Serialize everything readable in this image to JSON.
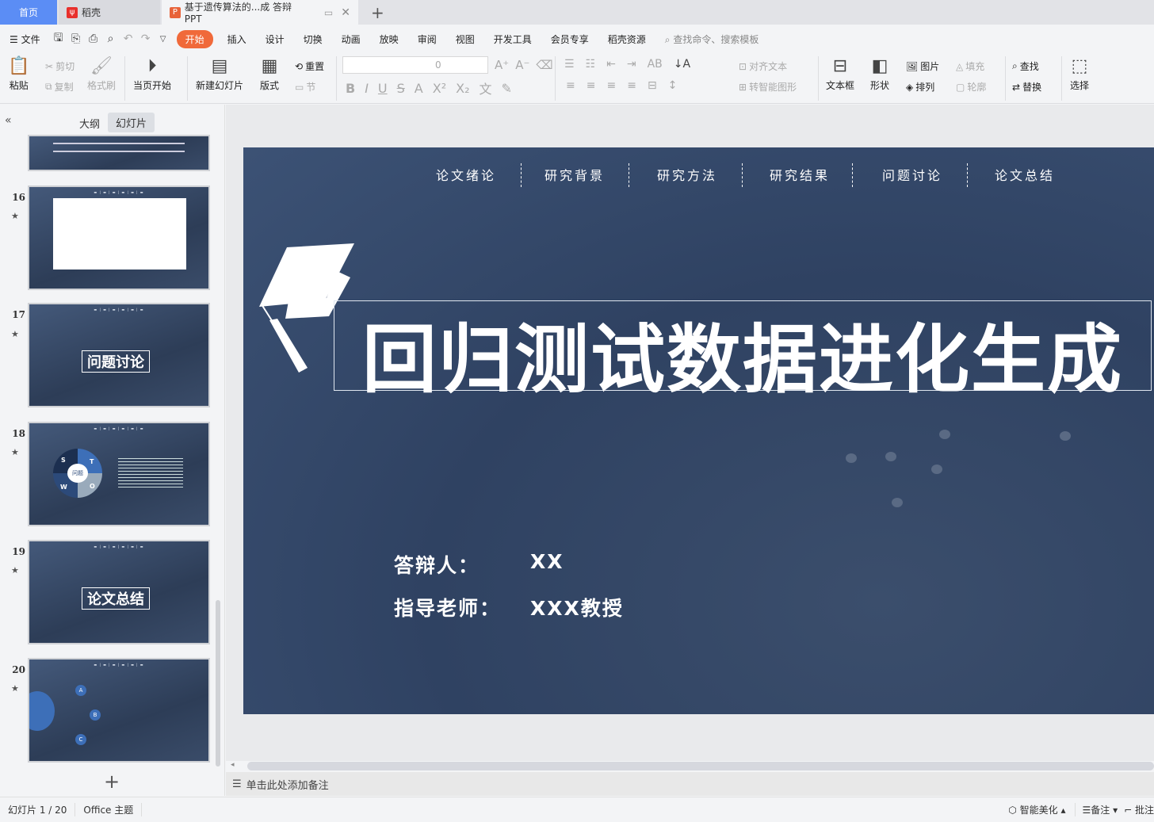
{
  "tabs": {
    "home": "首页",
    "daoke": "稻壳",
    "doc": "基于遗传算法的...成 答辩PPT",
    "new_tab": "+"
  },
  "menu": {
    "file": "文件",
    "items": [
      "开始",
      "插入",
      "设计",
      "切换",
      "动画",
      "放映",
      "审阅",
      "视图",
      "开发工具",
      "会员专享",
      "稻壳资源"
    ],
    "active": "开始",
    "search_placeholder": "查找命令、搜索模板"
  },
  "ribbon": {
    "paste": "粘贴",
    "cut": "剪切",
    "copy": "复制",
    "format_painter": "格式刷",
    "play_from_current": "当页开始",
    "new_slide": "新建幻灯片",
    "layout": "版式",
    "reset": "重置",
    "section": "节",
    "font_size": "0",
    "align_text": "对齐文本",
    "smart_art": "转智能图形",
    "text_box": "文本框",
    "shape": "形状",
    "picture": "图片",
    "fill": "填充",
    "arrange": "排列",
    "outline": "轮廓",
    "find": "查找",
    "replace": "替换",
    "select": "选择"
  },
  "panel": {
    "tab_outline": "大纲",
    "tab_slides": "幻灯片",
    "add": "+"
  },
  "thumbnails": [
    {
      "num": "16"
    },
    {
      "num": "17",
      "title": "问题讨论"
    },
    {
      "num": "18",
      "center": "问题",
      "letters": [
        "S",
        "T",
        "W",
        "O"
      ]
    },
    {
      "num": "19",
      "title": "论文总结"
    },
    {
      "num": "20",
      "letters": [
        "A",
        "B",
        "C"
      ]
    }
  ],
  "slide": {
    "nav": [
      "论文绪论",
      "研究背景",
      "研究方法",
      "研究结果",
      "问题讨论",
      "论文总结"
    ],
    "title": "回归测试数据进化生成",
    "presenter_label": "答辩人：",
    "presenter": "XX",
    "advisor_label": "指导老师：",
    "advisor": "XXX教授",
    "bg_color": "#34496a"
  },
  "notes_placeholder": "单击此处添加备注",
  "status": {
    "slide_count": "幻灯片 1 / 20",
    "theme": "Office 主题",
    "beautify": "智能美化",
    "notes": "备注",
    "comments": "批注"
  },
  "colors": {
    "accent": "#f0693a",
    "home_tab": "#5b8df5"
  }
}
